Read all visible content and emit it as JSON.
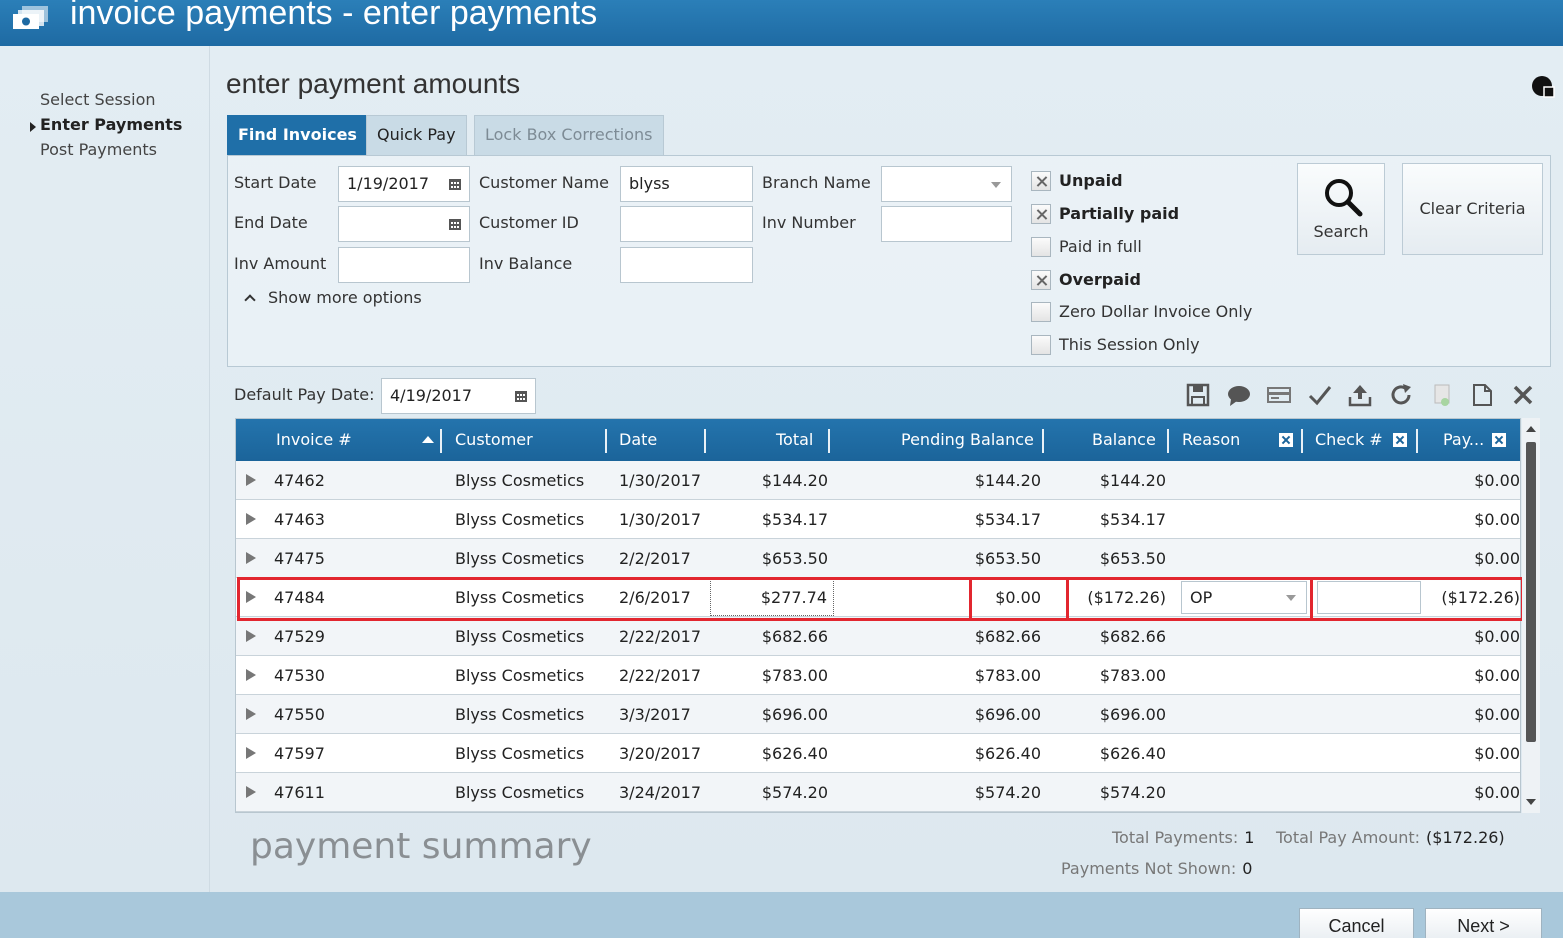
{
  "window": {
    "title": "invoice payments - enter payments"
  },
  "sidebar": {
    "items": [
      {
        "label": "Select Session"
      },
      {
        "label": "Enter Payments"
      },
      {
        "label": "Post Payments"
      }
    ]
  },
  "main": {
    "title": "enter payment amounts",
    "tabs": [
      {
        "label": "Find Invoices"
      },
      {
        "label": "Quick Pay"
      },
      {
        "label": "Lock Box Corrections"
      }
    ]
  },
  "criteria": {
    "start_date_label": "Start Date",
    "start_date": "1/19/2017",
    "end_date_label": "End Date",
    "end_date": "",
    "inv_amount_label": "Inv Amount",
    "inv_amount": "",
    "customer_name_label": "Customer Name",
    "customer_name": "blyss",
    "customer_id_label": "Customer ID",
    "customer_id": "",
    "inv_balance_label": "Inv Balance",
    "inv_balance": "",
    "branch_name_label": "Branch Name",
    "branch_name": "",
    "inv_number_label": "Inv Number",
    "inv_number": "",
    "show_more": "Show more options",
    "filters": [
      {
        "label": "Unpaid",
        "checked": true
      },
      {
        "label": "Partially paid",
        "checked": true
      },
      {
        "label": "Paid in full",
        "checked": false
      },
      {
        "label": "Overpaid",
        "checked": true
      },
      {
        "label": "Zero Dollar Invoice Only",
        "checked": false
      },
      {
        "label": "This Session Only",
        "checked": false
      }
    ],
    "search_label": "Search",
    "clear_label": "Clear Criteria"
  },
  "pay_date": {
    "label": "Default Pay Date:",
    "value": "4/19/2017"
  },
  "grid": {
    "columns": [
      "Invoice #",
      "Customer",
      "Date",
      "Total",
      "Pending Balance",
      "Balance",
      "Reason",
      "Check #",
      "Pay..."
    ],
    "rows": [
      {
        "invoice": "47462",
        "customer": "Blyss Cosmetics",
        "date": "1/30/2017",
        "total": "$144.20",
        "pending": "$144.20",
        "balance": "$144.20",
        "reason": "",
        "check": "",
        "pay": "$0.00"
      },
      {
        "invoice": "47463",
        "customer": "Blyss Cosmetics",
        "date": "1/30/2017",
        "total": "$534.17",
        "pending": "$534.17",
        "balance": "$534.17",
        "reason": "",
        "check": "",
        "pay": "$0.00"
      },
      {
        "invoice": "47475",
        "customer": "Blyss Cosmetics",
        "date": "2/2/2017",
        "total": "$653.50",
        "pending": "$653.50",
        "balance": "$653.50",
        "reason": "",
        "check": "",
        "pay": "$0.00"
      },
      {
        "invoice": "47484",
        "customer": "Blyss Cosmetics",
        "date": "2/6/2017",
        "total": "$277.74",
        "pending": "$0.00",
        "balance": "($172.26)",
        "reason": "OP",
        "check": "",
        "pay": "($172.26)"
      },
      {
        "invoice": "47529",
        "customer": "Blyss Cosmetics",
        "date": "2/22/2017",
        "total": "$682.66",
        "pending": "$682.66",
        "balance": "$682.66",
        "reason": "",
        "check": "",
        "pay": "$0.00"
      },
      {
        "invoice": "47530",
        "customer": "Blyss Cosmetics",
        "date": "2/22/2017",
        "total": "$783.00",
        "pending": "$783.00",
        "balance": "$783.00",
        "reason": "",
        "check": "",
        "pay": "$0.00"
      },
      {
        "invoice": "47550",
        "customer": "Blyss Cosmetics",
        "date": "3/3/2017",
        "total": "$696.00",
        "pending": "$696.00",
        "balance": "$696.00",
        "reason": "",
        "check": "",
        "pay": "$0.00"
      },
      {
        "invoice": "47597",
        "customer": "Blyss Cosmetics",
        "date": "3/20/2017",
        "total": "$626.40",
        "pending": "$626.40",
        "balance": "$626.40",
        "reason": "",
        "check": "",
        "pay": "$0.00"
      },
      {
        "invoice": "47611",
        "customer": "Blyss Cosmetics",
        "date": "3/24/2017",
        "total": "$574.20",
        "pending": "$574.20",
        "balance": "$574.20",
        "reason": "",
        "check": "",
        "pay": "$0.00"
      }
    ]
  },
  "summary": {
    "title": "payment summary",
    "total_payments_label": "Total Payments:",
    "total_payments": "1",
    "total_pay_amount_label": "Total Pay Amount:",
    "total_pay_amount": "($172.26)",
    "not_shown_label": "Payments Not Shown:",
    "not_shown": "0"
  },
  "footer": {
    "cancel_label": "Cancel",
    "next_label": "Next >"
  },
  "colors": {
    "accent": "#1f6fa8",
    "highlight": "#e2262f"
  }
}
